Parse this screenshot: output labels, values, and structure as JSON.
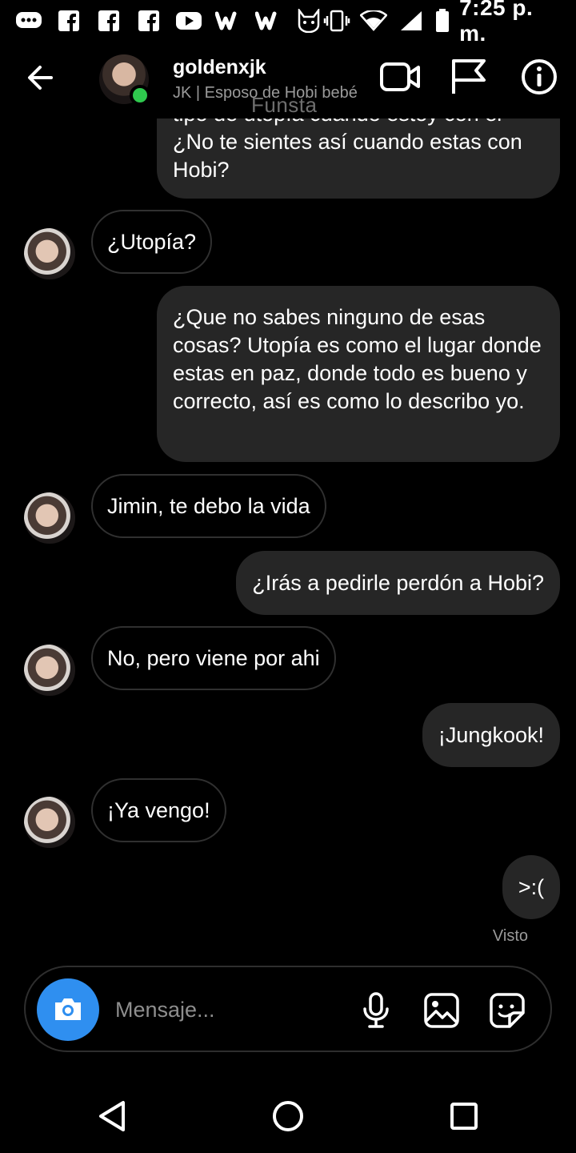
{
  "status_bar": {
    "time": "7:25 p. m.",
    "icons": [
      "chat-icon",
      "facebook-icon",
      "facebook-icon",
      "facebook-icon",
      "youtube-icon",
      "wattpad-icon",
      "wattpad-icon",
      "cat-icon",
      "vibrate-icon",
      "wifi-icon",
      "signal-icon",
      "battery-icon"
    ]
  },
  "header": {
    "username": "goldenxjk",
    "subtitle": "JK | Esposo de Hobi bebé",
    "watermark": "Funsta"
  },
  "messages": [
    {
      "side": "out",
      "text": "tipo de utopía cuando estoy con el ¿No te sientes así cuando estas con Hobi?"
    },
    {
      "side": "in",
      "text": "¿Utopía?"
    },
    {
      "side": "out",
      "text": "¿Que no sabes ninguno de esas cosas? Utopía es como el lugar donde estas en paz, donde todo es bueno y correcto, así es como lo describo yo."
    },
    {
      "side": "in",
      "text": "Jimin, te debo la vida"
    },
    {
      "side": "out",
      "text": "¿Irás a pedirle perdón a Hobi?"
    },
    {
      "side": "in",
      "text": "No, pero viene por ahi"
    },
    {
      "side": "out",
      "text": "¡Jungkook!"
    },
    {
      "side": "in",
      "text": "¡Ya vengo!"
    },
    {
      "side": "out",
      "text": ">:("
    }
  ],
  "seen_label": "Visto",
  "composer": {
    "placeholder": "Mensaje..."
  },
  "colors": {
    "background": "#000000",
    "outgoing_bubble": "#262626",
    "incoming_border": "#303030",
    "camera_button": "#2f8ff0",
    "online": "#2fc94e"
  }
}
